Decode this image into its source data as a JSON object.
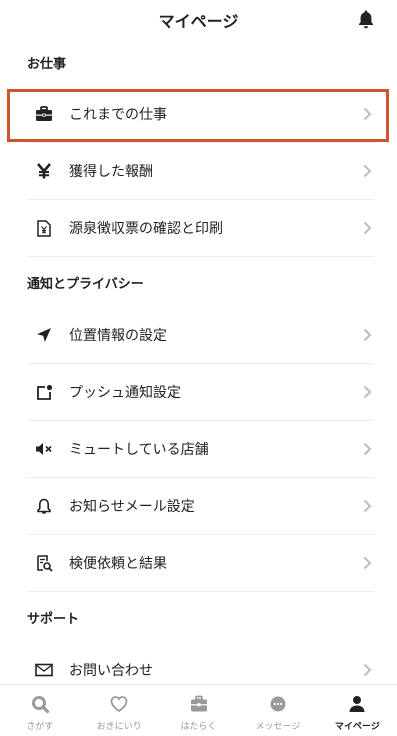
{
  "header": {
    "title": "マイページ",
    "notification_icon": "bell-icon"
  },
  "sections": [
    {
      "title": "お仕事",
      "items": [
        {
          "label": "これまでの仕事",
          "icon": "briefcase-icon"
        },
        {
          "label": "獲得した報酬",
          "icon": "yen-icon"
        },
        {
          "label": "源泉徴収票の確認と印刷",
          "icon": "receipt-icon"
        }
      ]
    },
    {
      "title": "通知とプライバシー",
      "items": [
        {
          "label": "位置情報の設定",
          "icon": "location-arrow-icon"
        },
        {
          "label": "プッシュ通知設定",
          "icon": "push-notification-icon"
        },
        {
          "label": "ミュートしている店舗",
          "icon": "mute-icon"
        },
        {
          "label": "お知らせメール設定",
          "icon": "bell-icon"
        },
        {
          "label": "検便依頼と結果",
          "icon": "test-search-icon"
        }
      ]
    },
    {
      "title": "サポート",
      "items": [
        {
          "label": "お問い合わせ",
          "icon": "mail-icon"
        }
      ]
    }
  ],
  "tabbar": [
    {
      "label": "さがす",
      "icon": "search-icon",
      "active": false
    },
    {
      "label": "おきにいり",
      "icon": "heart-icon",
      "active": false
    },
    {
      "label": "はたらく",
      "icon": "briefcase-icon",
      "active": false
    },
    {
      "label": "メッセージ",
      "icon": "chat-icon",
      "active": false
    },
    {
      "label": "マイページ",
      "icon": "person-icon",
      "active": true
    }
  ],
  "colors": {
    "highlight": "#d2532e",
    "inactive_tab": "#9a9a9a",
    "text": "#222222"
  }
}
